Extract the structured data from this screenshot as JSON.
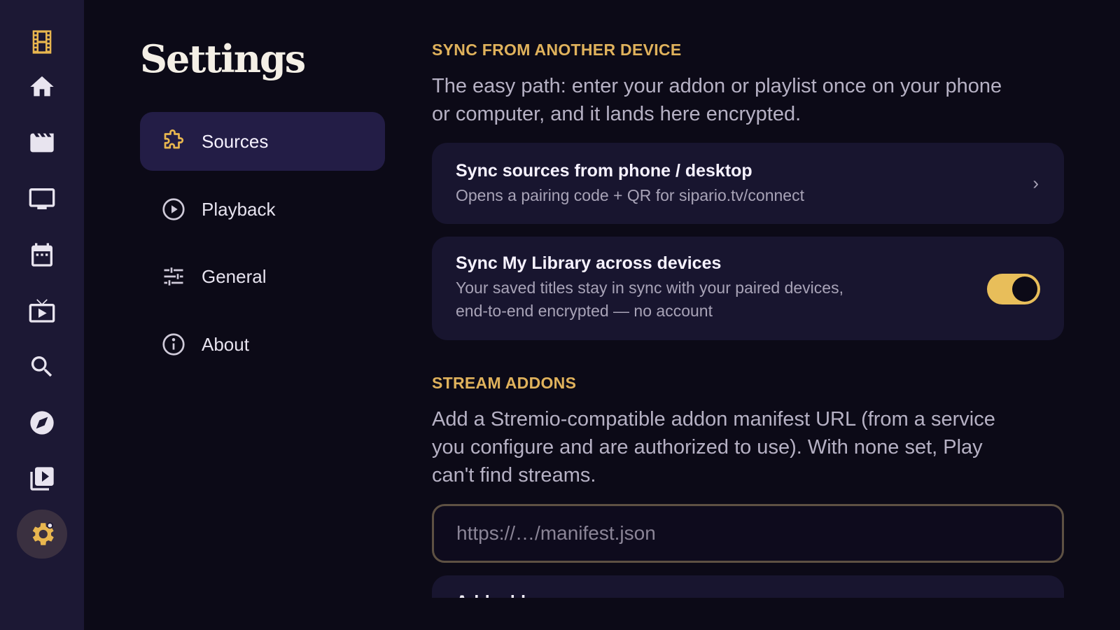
{
  "rail": {
    "logo_icon": "film-strip-icon",
    "items": [
      {
        "icon": "home-icon"
      },
      {
        "icon": "movies-clapper-icon"
      },
      {
        "icon": "tv-monitor-icon"
      },
      {
        "icon": "calendar-icon"
      },
      {
        "icon": "live-tv-icon"
      },
      {
        "icon": "search-icon"
      },
      {
        "icon": "compass-icon"
      },
      {
        "icon": "video-library-icon"
      },
      {
        "icon": "settings-gear-icon",
        "active": true
      }
    ]
  },
  "page": {
    "title": "Settings"
  },
  "menu": {
    "items": [
      {
        "label": "Sources",
        "icon": "puzzle-piece-icon",
        "active": true
      },
      {
        "label": "Playback",
        "icon": "play-circle-icon"
      },
      {
        "label": "General",
        "icon": "sliders-icon"
      },
      {
        "label": "About",
        "icon": "info-circle-icon"
      }
    ]
  },
  "sync": {
    "heading": "SYNC FROM ANOTHER DEVICE",
    "description": "The easy path: enter your addon or playlist once on your phone or computer, and it lands here encrypted.",
    "pair_card": {
      "title": "Sync sources from phone / desktop",
      "subtitle": "Opens a pairing code + QR for sipario.tv/connect",
      "chevron": "›"
    },
    "library_card": {
      "title": "Sync My Library across devices",
      "subtitle_line1": "Your saved titles stay in sync with your paired devices,",
      "subtitle_line2": "end-to-end encrypted — no account",
      "toggle_on": true
    }
  },
  "addons": {
    "heading": "STREAM ADDONS",
    "description": "Add a Stremio-compatible addon manifest URL (from a service you configure and are authorized to use). With none set, Play can't find streams.",
    "url_placeholder": "https://…/manifest.json",
    "add_button_label": "Add addon"
  },
  "colors": {
    "accent": "#e8b64f",
    "rail_bg": "#1c1834",
    "page_bg": "#0c0a17",
    "card_bg": "#18152f"
  }
}
